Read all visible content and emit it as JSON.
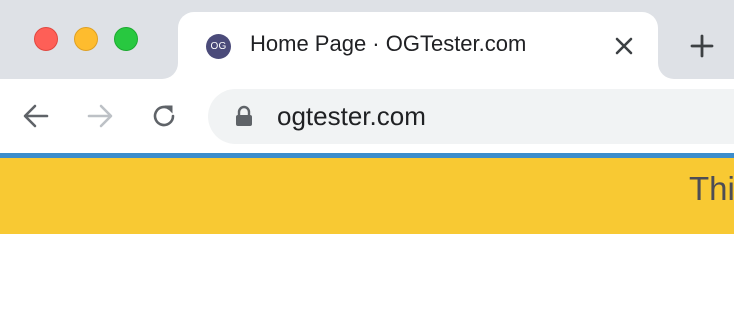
{
  "window": {
    "traffic_lights": {
      "close_color": "#fe5f57",
      "minimize_color": "#febc2e",
      "zoom_color": "#28c840"
    }
  },
  "tab": {
    "favicon_text": "OG",
    "favicon_color": "#4b4b7a",
    "title": "Home Page · OGTester.com",
    "close_icon": "close-icon",
    "new_tab_icon": "plus-icon"
  },
  "toolbar": {
    "back_icon": "arrow-left-icon",
    "forward_icon": "arrow-right-icon",
    "reload_icon": "reload-icon",
    "lock_icon": "lock-icon",
    "url": "ogtester.com"
  },
  "page": {
    "accent_color": "#3c8dcc",
    "banner_color": "#f8c933",
    "banner_text": "Thi"
  }
}
